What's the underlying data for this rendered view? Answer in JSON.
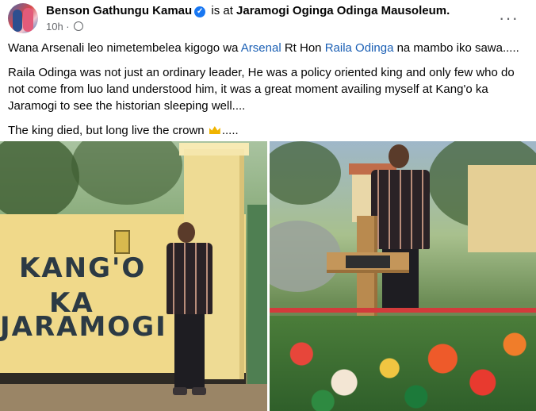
{
  "post": {
    "author": "Benson Gathungu Kamau",
    "is_at": "is at",
    "location": "Jaramogi Oginga Odinga Mausoleum.",
    "time": "10h ·",
    "more": "···"
  },
  "text": {
    "p1_a": "Wana Arsenali leo nimetembelea kigogo wa ",
    "p1_link1": "Arsenal",
    "p1_b": " Rt Hon ",
    "p1_link2": "Raila Odinga",
    "p1_c": " na mambo iko sawa.....",
    "p2": "Raila Odinga was not just an ordinary leader, He was a policy oriented king and only few who do not come from luo land understood him, it was a great moment availing myself at Kang'o ka Jaramogi to see the historian sleeping well....",
    "p3_a": "The king died, but long live the crown ",
    "p3_b": "....."
  },
  "photo_left": {
    "sign_line1": "KANG'O",
    "sign_line2": "KA",
    "sign_line3": "JARAMOGI"
  },
  "colors": {
    "link": "#1a5fb4",
    "verified": "#1877f2",
    "meta": "#65676b"
  },
  "icons": [
    "verified-badge-icon",
    "globe-icon",
    "more-options-icon",
    "crown-emoji-icon"
  ]
}
